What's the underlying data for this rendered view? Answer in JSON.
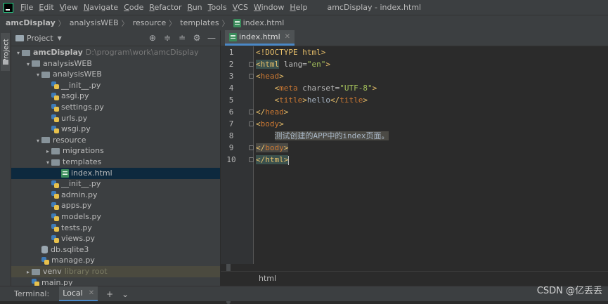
{
  "menubar": {
    "items": [
      {
        "label": "File",
        "u": "F",
        "rest": "ile"
      },
      {
        "label": "Edit",
        "u": "E",
        "rest": "dit"
      },
      {
        "label": "View",
        "u": "V",
        "rest": "iew"
      },
      {
        "label": "Navigate",
        "u": "N",
        "rest": "avigate"
      },
      {
        "label": "Code",
        "u": "C",
        "rest": "ode"
      },
      {
        "label": "Refactor",
        "u": "R",
        "rest": "efactor"
      },
      {
        "label": "Run",
        "u": "R",
        "rest": "un"
      },
      {
        "label": "Tools",
        "u": "T",
        "rest": "ools"
      },
      {
        "label": "VCS",
        "u": "V",
        "rest": "CS"
      },
      {
        "label": "Window",
        "u": "W",
        "rest": "indow"
      },
      {
        "label": "Help",
        "u": "H",
        "rest": "elp"
      }
    ],
    "window_title": "amcDisplay - index.html"
  },
  "navbar": {
    "crumbs": [
      "amcDisplay",
      "analysisWEB",
      "resource",
      "templates",
      "index.html"
    ]
  },
  "sidestrip": {
    "label": "Project"
  },
  "project_panel": {
    "title": "Project",
    "tree": [
      {
        "depth": 0,
        "arrow": "▾",
        "icon": "folder",
        "label": "amcDisplay",
        "hint": "D:\\program\\work\\amcDisplay",
        "bold": true
      },
      {
        "depth": 1,
        "arrow": "▾",
        "icon": "folder",
        "label": "analysisWEB"
      },
      {
        "depth": 2,
        "arrow": "▾",
        "icon": "folder",
        "label": "analysisWEB"
      },
      {
        "depth": 3,
        "arrow": "",
        "icon": "py",
        "label": "__init__.py"
      },
      {
        "depth": 3,
        "arrow": "",
        "icon": "py",
        "label": "asgi.py"
      },
      {
        "depth": 3,
        "arrow": "",
        "icon": "py",
        "label": "settings.py"
      },
      {
        "depth": 3,
        "arrow": "",
        "icon": "py",
        "label": "urls.py"
      },
      {
        "depth": 3,
        "arrow": "",
        "icon": "py",
        "label": "wsgi.py"
      },
      {
        "depth": 2,
        "arrow": "▾",
        "icon": "folder",
        "label": "resource"
      },
      {
        "depth": 3,
        "arrow": "▸",
        "icon": "folder",
        "label": "migrations"
      },
      {
        "depth": 3,
        "arrow": "▾",
        "icon": "folder",
        "label": "templates"
      },
      {
        "depth": 4,
        "arrow": "",
        "icon": "html",
        "label": "index.html",
        "selected": true
      },
      {
        "depth": 3,
        "arrow": "",
        "icon": "py",
        "label": "__init__.py"
      },
      {
        "depth": 3,
        "arrow": "",
        "icon": "py",
        "label": "admin.py"
      },
      {
        "depth": 3,
        "arrow": "",
        "icon": "py",
        "label": "apps.py"
      },
      {
        "depth": 3,
        "arrow": "",
        "icon": "py",
        "label": "models.py"
      },
      {
        "depth": 3,
        "arrow": "",
        "icon": "py",
        "label": "tests.py"
      },
      {
        "depth": 3,
        "arrow": "",
        "icon": "py",
        "label": "views.py"
      },
      {
        "depth": 2,
        "arrow": "",
        "icon": "db",
        "label": "db.sqlite3"
      },
      {
        "depth": 2,
        "arrow": "",
        "icon": "py",
        "label": "manage.py"
      },
      {
        "depth": 1,
        "arrow": "▸",
        "icon": "folder",
        "label": "venv",
        "hint": "library root",
        "excluded": true
      },
      {
        "depth": 1,
        "arrow": "",
        "icon": "py",
        "label": "main.py"
      }
    ]
  },
  "editor": {
    "tab_label": "index.html",
    "line_numbers": [
      "1",
      "2",
      "3",
      "4",
      "5",
      "6",
      "7",
      "8",
      "9",
      "10"
    ],
    "breadcrumb": "html"
  },
  "bottom": {
    "terminal_label": "Terminal:",
    "terminal_tab": "Local",
    "add": "+",
    "more": "⌄"
  },
  "watermark": "CSDN @亿丢丢"
}
